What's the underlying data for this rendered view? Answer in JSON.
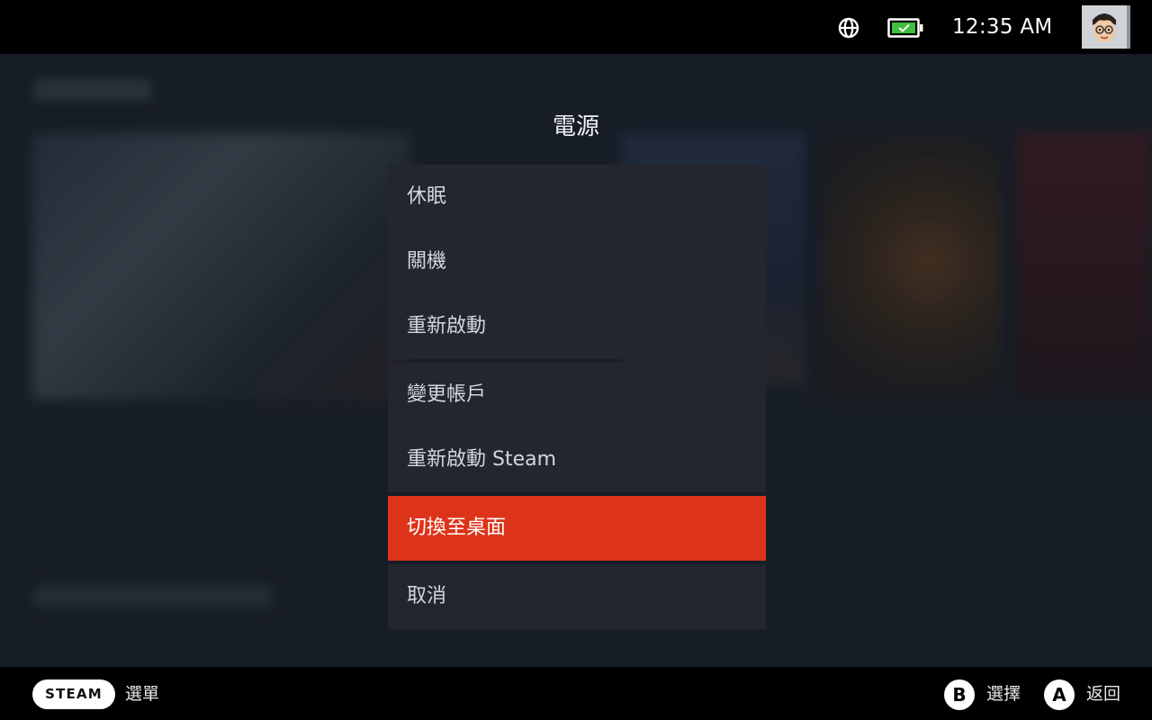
{
  "status_bar": {
    "time": "12:35 AM",
    "globe_icon": "globe-icon",
    "battery_icon": "battery-charging-icon",
    "battery_color": "#3fbf3f",
    "avatar_icon": "user-avatar"
  },
  "dialog": {
    "title": "電源",
    "groups": [
      [
        "休眠",
        "關機",
        "重新啟動"
      ],
      [
        "變更帳戶",
        "重新啟動 Steam"
      ],
      [
        "切換至桌面"
      ],
      [
        "取消"
      ]
    ],
    "selected": "切換至桌面",
    "accent_color": "#dd3419"
  },
  "bottom_bar": {
    "steam_label": "STEAM",
    "steam_hint": "選單",
    "b_key": "B",
    "b_hint": "選擇",
    "a_key": "A",
    "a_hint": "返回"
  }
}
